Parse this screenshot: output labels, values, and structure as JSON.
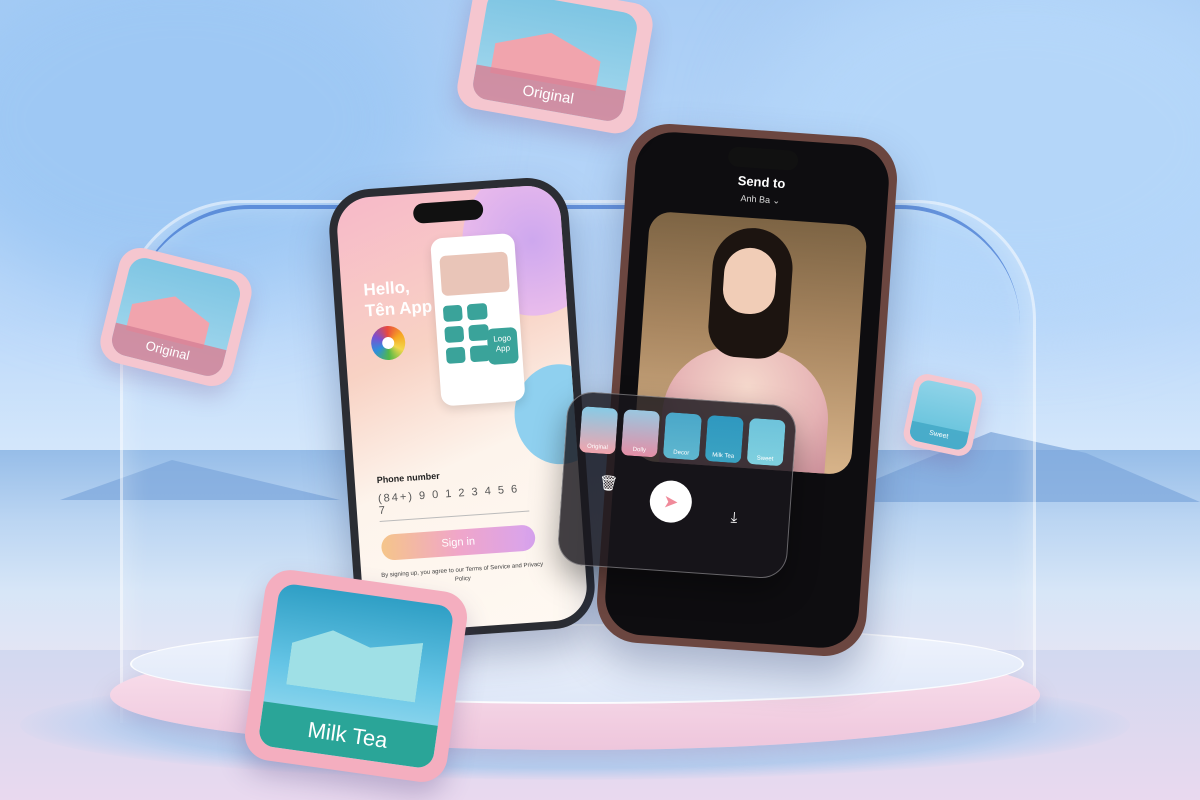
{
  "left_phone": {
    "greeting": "Hello,",
    "app_name": "Tên App",
    "mini_logo_text": "Logo App",
    "phone_label": "Phone number",
    "phone_value": "(84+) 9 0 1 2 3 4 5 6 7",
    "signin_label": "Sign in",
    "terms_text": "By signing up, you agree to our Terms of Service and Privacy Policy"
  },
  "right_phone": {
    "send_to": "Send to",
    "recipient": "Anh Ba"
  },
  "panel": {
    "thumbs": [
      {
        "label": "Original",
        "color": "#f1a4ad"
      },
      {
        "label": "Dolly",
        "color": "#e48fa6"
      },
      {
        "label": "Decor",
        "color": "#5fb7cf"
      },
      {
        "label": "Milk Tea",
        "color": "#3ba3c2"
      },
      {
        "label": "Sweet",
        "color": "#7fd0df"
      }
    ]
  },
  "tiles": {
    "top_original": "Original",
    "left_original": "Original",
    "right_sweet": "Sweet",
    "milk_tea": "Milk Tea"
  },
  "colors": {
    "accent_pink": "#f4aebf",
    "accent_teal": "#2aa598",
    "arch_blue": "#2a63c9"
  }
}
